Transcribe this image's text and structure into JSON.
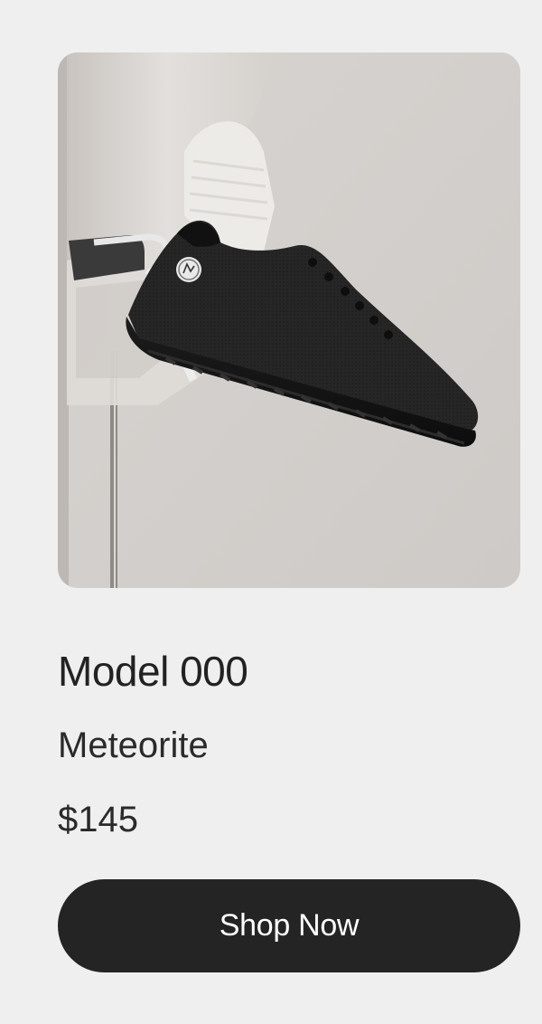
{
  "product": {
    "name": "Model 000",
    "colorway": "Meteorite",
    "price": "$145",
    "image_alt": "Black knit sneaker on a foot in a white sock against a light gray background"
  },
  "cta": {
    "label": "Shop Now"
  },
  "colors": {
    "background": "#efefef",
    "button": "#242424",
    "button_text": "#ffffff",
    "text": "#222222"
  }
}
